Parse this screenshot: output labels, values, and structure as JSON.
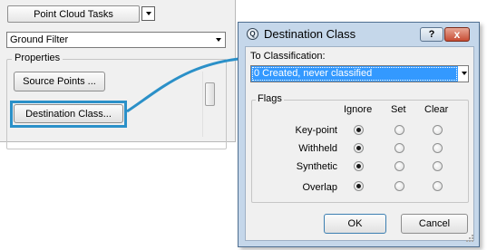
{
  "left_panel": {
    "tasks_button_label": "Point Cloud Tasks",
    "filter_select_value": "Ground Filter",
    "properties_legend": "Properties",
    "source_points_label": "Source Points ...",
    "destination_class_label": "Destination Class..."
  },
  "dialog": {
    "title": "Destination Class",
    "help_label": "?",
    "close_label": "x",
    "to_classification_label": "To Classification:",
    "classification_value": "0   Created, never classified",
    "flags_legend": "Flags",
    "columns": [
      "Ignore",
      "Set",
      "Clear"
    ],
    "rows": [
      {
        "label": "Key-point",
        "selected": "Ignore"
      },
      {
        "label": "Withheld",
        "selected": "Ignore"
      },
      {
        "label": "Synthetic",
        "selected": "Ignore"
      },
      {
        "label": "Overlap",
        "selected": "Ignore"
      }
    ],
    "ok_label": "OK",
    "cancel_label": "Cancel"
  },
  "colors": {
    "highlight": "#2b90c8",
    "selection": "#3399ff",
    "title_bar": "#c5d7ea",
    "close_button": "#c74c33"
  }
}
